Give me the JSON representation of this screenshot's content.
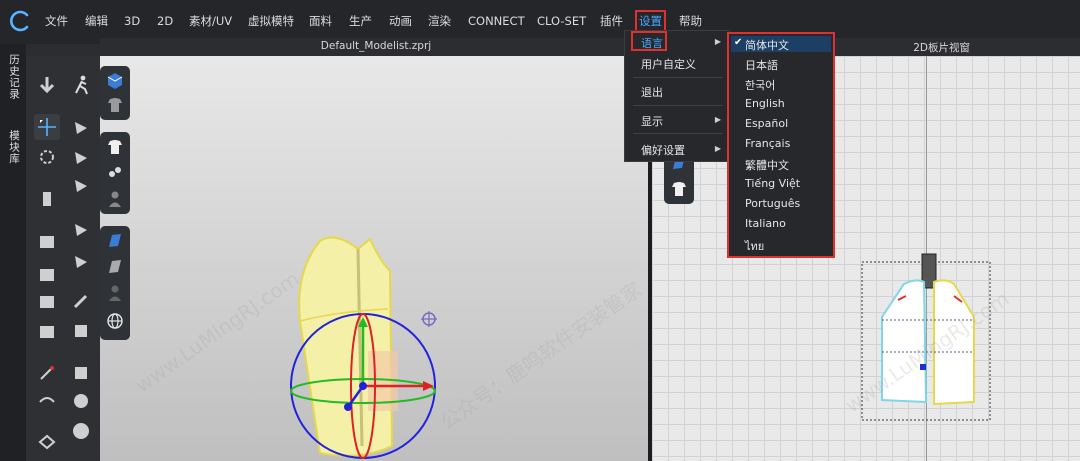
{
  "menubar": {
    "items": [
      "文件",
      "编辑",
      "3D",
      "2D",
      "素材/UV",
      "虚拟模特",
      "面料",
      "生产",
      "动画",
      "渲染",
      "CONNECT",
      "CLO-SET",
      "插件",
      "设置",
      "帮助"
    ]
  },
  "document": {
    "title": "Default_Modelist.zprj"
  },
  "view2d": {
    "title": "2D板片视窗"
  },
  "side_tabs": [
    "历史记录",
    "模块库"
  ],
  "settings_menu": {
    "items": [
      {
        "label": "语言",
        "has_submenu": true
      },
      {
        "label": "用户自定义",
        "has_submenu": false
      },
      {
        "label": "退出",
        "has_submenu": false
      },
      {
        "label": "显示",
        "has_submenu": true
      },
      {
        "label": "偏好设置",
        "has_submenu": true
      }
    ]
  },
  "language_menu": {
    "selected": "简体中文",
    "items": [
      "简体中文",
      "日本語",
      "한국어",
      "English",
      "Español",
      "Français",
      "繁體中文",
      "Tiếng Việt",
      "Português",
      "Italiano",
      "ไทย"
    ]
  },
  "watermark": {
    "texts": [
      "www.LuMingRJ.com",
      "公众号：鹿鸣软件安装管家"
    ]
  },
  "colors": {
    "accent": "#4aa8ff",
    "highlight": "#e03131",
    "garment": "#f4f0a8",
    "selection_bg": "#1d3f66"
  },
  "icons": [
    "logo-icon",
    "arrow-icon",
    "walk-icon",
    "move-icon",
    "gizmo-icon",
    "shirt-icon",
    "globe-icon",
    "cube-icon",
    "check-icon",
    "submenu-arrow-icon"
  ]
}
